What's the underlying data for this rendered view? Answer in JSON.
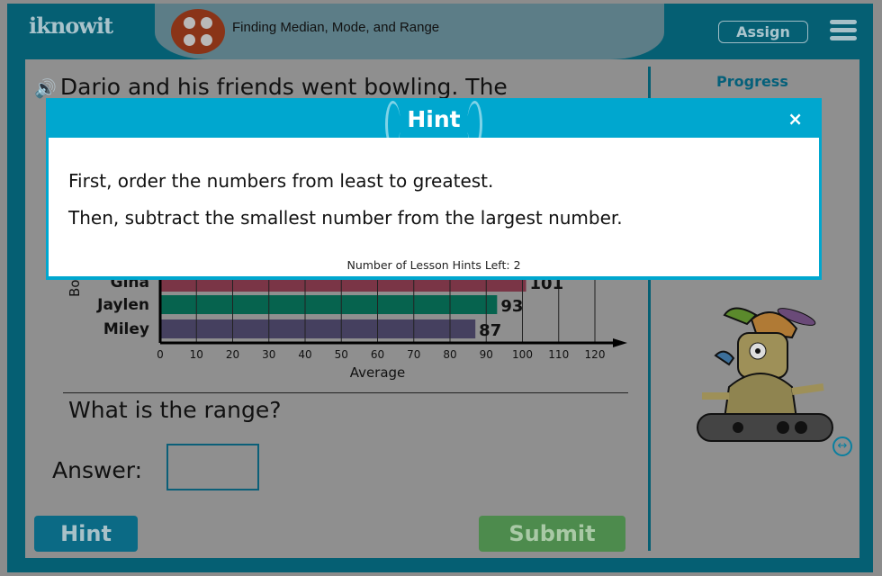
{
  "header": {
    "logo": "iknowit",
    "title": "Finding Median, Mode, and Range",
    "assign_label": "Assign"
  },
  "question": {
    "text": "Dario and his friends went bowling. The",
    "prompt": "What is the range?",
    "answer_label": "Answer:",
    "answer_value": ""
  },
  "sidebar": {
    "progress_label": "Progress"
  },
  "buttons": {
    "hint": "Hint",
    "submit": "Submit"
  },
  "chart_data": {
    "type": "bar",
    "orientation": "horizontal",
    "categories": [
      "Gina",
      "Jaylen",
      "Miley"
    ],
    "values": [
      101,
      93,
      87
    ],
    "value_labels": [
      "101",
      "93",
      "87"
    ],
    "colors": [
      "#7a3546",
      "#06634e",
      "#45405f"
    ],
    "xlabel": "Average",
    "ylabel": "Bo",
    "xlim": [
      0,
      120
    ],
    "xticks": [
      "0",
      "10",
      "20",
      "30",
      "40",
      "50",
      "60",
      "70",
      "80",
      "90",
      "100",
      "110",
      "120"
    ],
    "grid": true
  },
  "modal": {
    "title": "Hint",
    "close": "×",
    "lines": [
      "First, order the numbers from least to greatest.",
      "Then, subtract the smallest number from the largest number."
    ],
    "hints_left": "Number of Lesson Hints Left: 2"
  }
}
